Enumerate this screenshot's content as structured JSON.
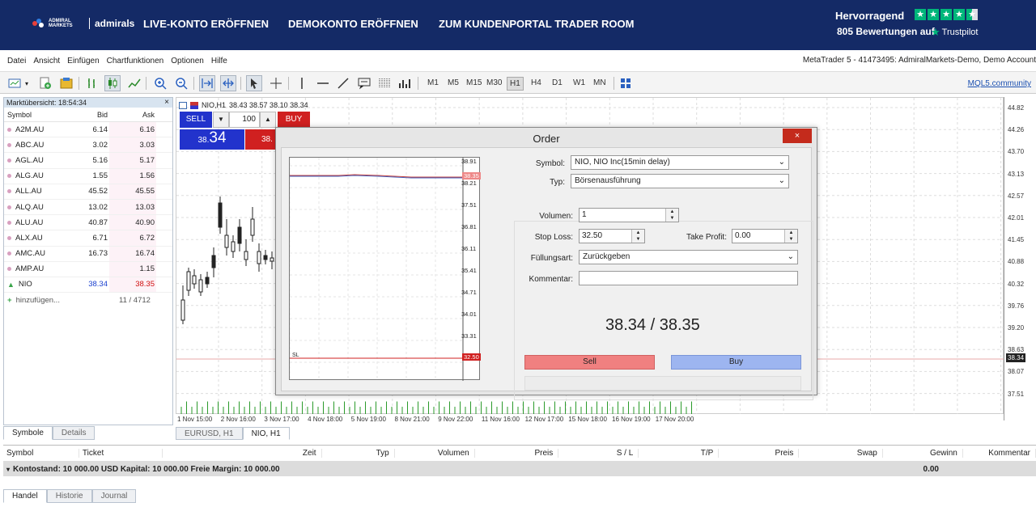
{
  "banner": {
    "logo_small": "ADMIRAL MARKETS",
    "logo_main": "admirals",
    "nav": [
      "LIVE-KONTO ERÖFFNEN",
      "DEMOKONTO ERÖFFNEN",
      "ZUM KUNDENPORTAL TRADER ROOM"
    ],
    "rating_title": "Hervorragend",
    "reviews_count": "805",
    "reviews_text": "Bewertungen auf",
    "trustpilot": "Trustpilot",
    "colors": {
      "bg": "#142a66",
      "trustpilot_green": "#00b67a"
    }
  },
  "menu": [
    "Datei",
    "Ansicht",
    "Einfügen",
    "Chartfunktionen",
    "Optionen",
    "Hilfe"
  ],
  "window_title": "MetaTrader 5 - 41473495: AdmiralMarkets-Demo, Demo Account",
  "toolbar": {
    "timeframes": [
      "M1",
      "M5",
      "M15",
      "M30",
      "H1",
      "H4",
      "D1",
      "W1",
      "MN"
    ],
    "active_timeframe": "H1",
    "community_link": "MQL5.community"
  },
  "market_watch": {
    "title": "Marktübersicht: 18:54:34",
    "columns": {
      "symbol": "Symbol",
      "bid": "Bid",
      "ask": "Ask"
    },
    "rows": [
      {
        "symbol": "A2M.AU",
        "bid": "6.14",
        "ask": "6.16"
      },
      {
        "symbol": "ABC.AU",
        "bid": "3.02",
        "ask": "3.03"
      },
      {
        "symbol": "AGL.AU",
        "bid": "5.16",
        "ask": "5.17"
      },
      {
        "symbol": "ALG.AU",
        "bid": "1.55",
        "ask": "1.56"
      },
      {
        "symbol": "ALL.AU",
        "bid": "45.52",
        "ask": "45.55"
      },
      {
        "symbol": "ALQ.AU",
        "bid": "13.02",
        "ask": "13.03"
      },
      {
        "symbol": "ALU.AU",
        "bid": "40.87",
        "ask": "40.90"
      },
      {
        "symbol": "ALX.AU",
        "bid": "6.71",
        "ask": "6.72"
      },
      {
        "symbol": "AMC.AU",
        "bid": "16.73",
        "ask": "16.74"
      },
      {
        "symbol": "AMP.AU",
        "bid": "",
        "ask": "1.15"
      },
      {
        "symbol": "NIO",
        "bid": "38.34",
        "ask": "38.35"
      }
    ],
    "add_label": "hinzufügen...",
    "count": "11 / 4712",
    "tabs": [
      "Symbole",
      "Details"
    ]
  },
  "chart": {
    "title": "NIO,H1",
    "ohlc": "38.43 38.57 38.10 38.34",
    "sell_label": "SELL",
    "buy_label": "BUY",
    "lot": "100",
    "sell_price_small": "38.",
    "sell_price_big": "34",
    "buy_price_small": "38.",
    "y_labels": [
      "44.82",
      "44.26",
      "43.70",
      "43.13",
      "42.57",
      "42.01",
      "41.45",
      "40.88",
      "40.32",
      "39.76",
      "39.20",
      "38.63",
      "38.07",
      "37.51"
    ],
    "current_price": "38.34",
    "x_labels": [
      "1 Nov 15:00",
      "2 Nov 16:00",
      "3 Nov 17:00",
      "4 Nov 18:00",
      "5 Nov 19:00",
      "8 Nov 21:00",
      "9 Nov 22:00",
      "11 Nov 16:00",
      "12 Nov 17:00",
      "15 Nov 18:00",
      "16 Nov 19:00",
      "17 Nov 20:00"
    ],
    "tabs": [
      "EURUSD, H1",
      "NIO, H1"
    ]
  },
  "order": {
    "title": "Order",
    "close": "×",
    "symbol_label": "Symbol:",
    "symbol_value": "NIO, NIO Inc(15min delay)",
    "type_label": "Typ:",
    "type_value": "Börsenausführung",
    "volume_label": "Volumen:",
    "volume_value": "1",
    "sl_label": "Stop Loss:",
    "sl_value": "32.50",
    "tp_label": "Take Profit:",
    "tp_value": "0.00",
    "fill_label": "Füllungsart:",
    "fill_value": "Zurückgeben",
    "comment_label": "Kommentar:",
    "comment_value": "",
    "price_display": "38.34 / 38.35",
    "sell_button": "Sell",
    "buy_button": "Buy",
    "mini_labels": [
      "38.91",
      "38.21",
      "37.51",
      "36.81",
      "36.11",
      "35.41",
      "34.71",
      "34.01",
      "33.31"
    ],
    "mini_current": "38.35",
    "mini_sl": "32.50",
    "mini_sl_text": "SL"
  },
  "terminal": {
    "columns": [
      "Symbol",
      "Ticket",
      "Zeit",
      "Typ",
      "Volumen",
      "Preis",
      "S / L",
      "T/P",
      "Preis",
      "Swap",
      "Gewinn",
      "Kommentar"
    ],
    "balance_row": "Kontostand: 10 000.00 USD  Kapital: 10 000.00  Freie Margin: 10 000.00",
    "profit": "0.00",
    "tabs": [
      "Handel",
      "Historie",
      "Journal"
    ]
  }
}
